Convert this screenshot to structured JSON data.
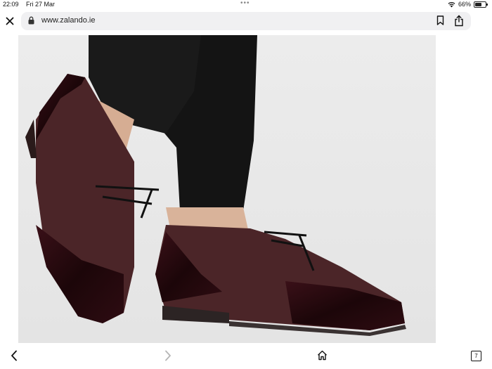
{
  "status_bar": {
    "time": "22:09",
    "date": "Fri 27 Mar",
    "battery_percent": "66%",
    "battery_level": 0.66,
    "multitask_dots": "•••"
  },
  "browser": {
    "url": "www.zalando.ie",
    "tab_count": "7"
  },
  "icons": {
    "close": "close-icon",
    "lock": "lock-icon",
    "bookmark": "bookmark-icon",
    "share": "share-icon",
    "back": "chevron-left-icon",
    "forward": "chevron-right-icon",
    "home": "home-icon",
    "tabs": "tabs-icon",
    "wifi": "wifi-icon",
    "battery": "battery-icon"
  },
  "colors": {
    "url_field_bg": "#f0f0f2",
    "shoe_leather": "#2a0d13",
    "shoe_suede": "#4d2a2c",
    "trousers": "#141414",
    "photo_bg": "#ebebeb"
  }
}
